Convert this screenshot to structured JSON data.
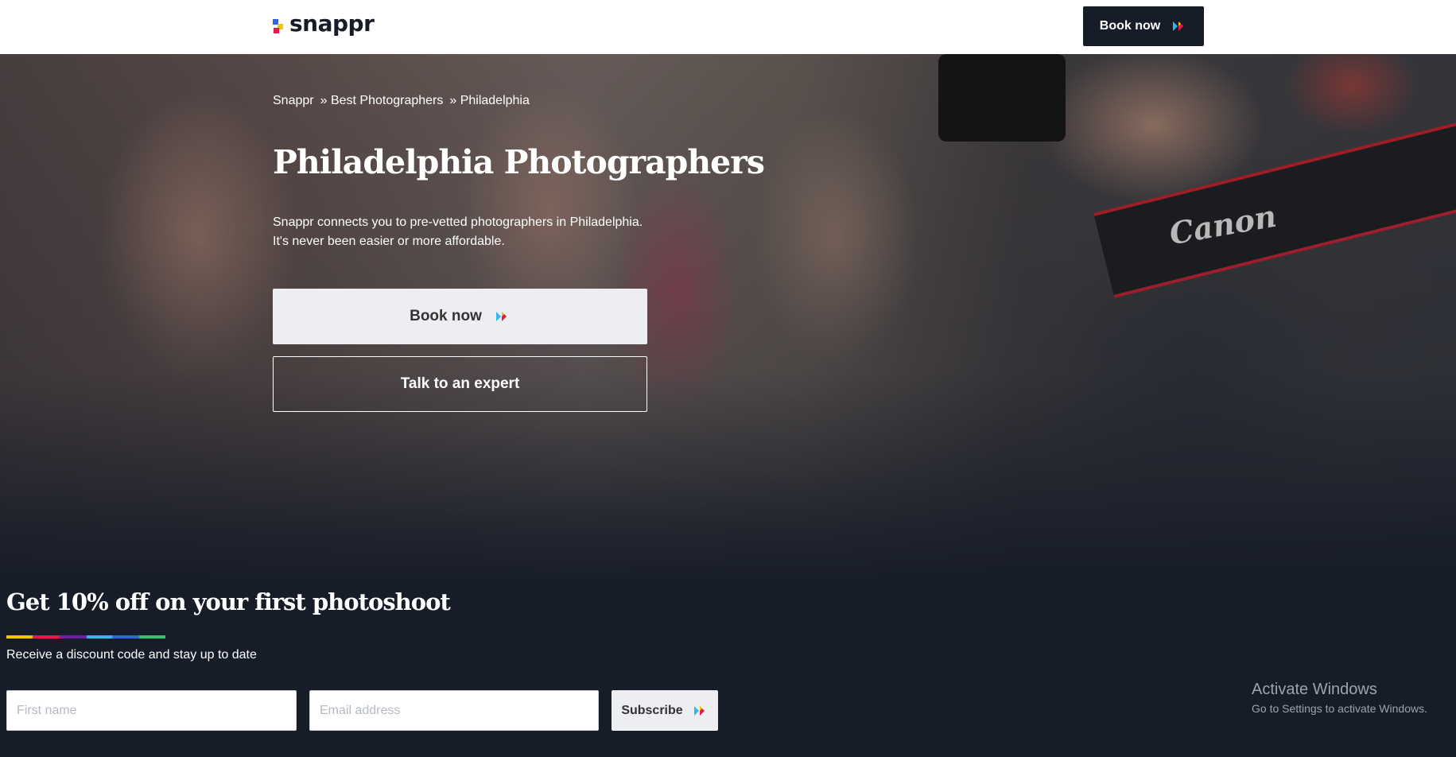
{
  "header": {
    "logo_text": "snappr",
    "book_button_label": "Book now"
  },
  "hero": {
    "breadcrumb": [
      "Snappr",
      "» Best Photographers",
      "» Philadelphia"
    ],
    "title": "Philadelphia Photographers",
    "description_line1": "Snappr connects you to pre-vetted photographers in Philadelphia.",
    "description_line2": "It's never been easier or more affordable.",
    "book_button_label": "Book now",
    "expert_button_label": "Talk to an expert",
    "background_brand_text": "Canon"
  },
  "promo": {
    "title": "Get 10% off on your first photoshoot",
    "subtitle": "Receive a discount code and stay up to date",
    "first_name_placeholder": "First name",
    "email_placeholder": "Email address",
    "subscribe_label": "Subscribe"
  },
  "watermark": {
    "title": "Activate Windows",
    "subtitle": "Go to Settings to activate Windows."
  },
  "colors": {
    "dark": "#161c28",
    "light_button": "#eceef2",
    "rainbow": [
      "#f5c400",
      "#e4194b",
      "#6e1fa0",
      "#33b7e6",
      "#2f67d8",
      "#2fc46e"
    ]
  },
  "icons": [
    "snappr-logo-icon",
    "double-chevron-arrow-icon"
  ]
}
